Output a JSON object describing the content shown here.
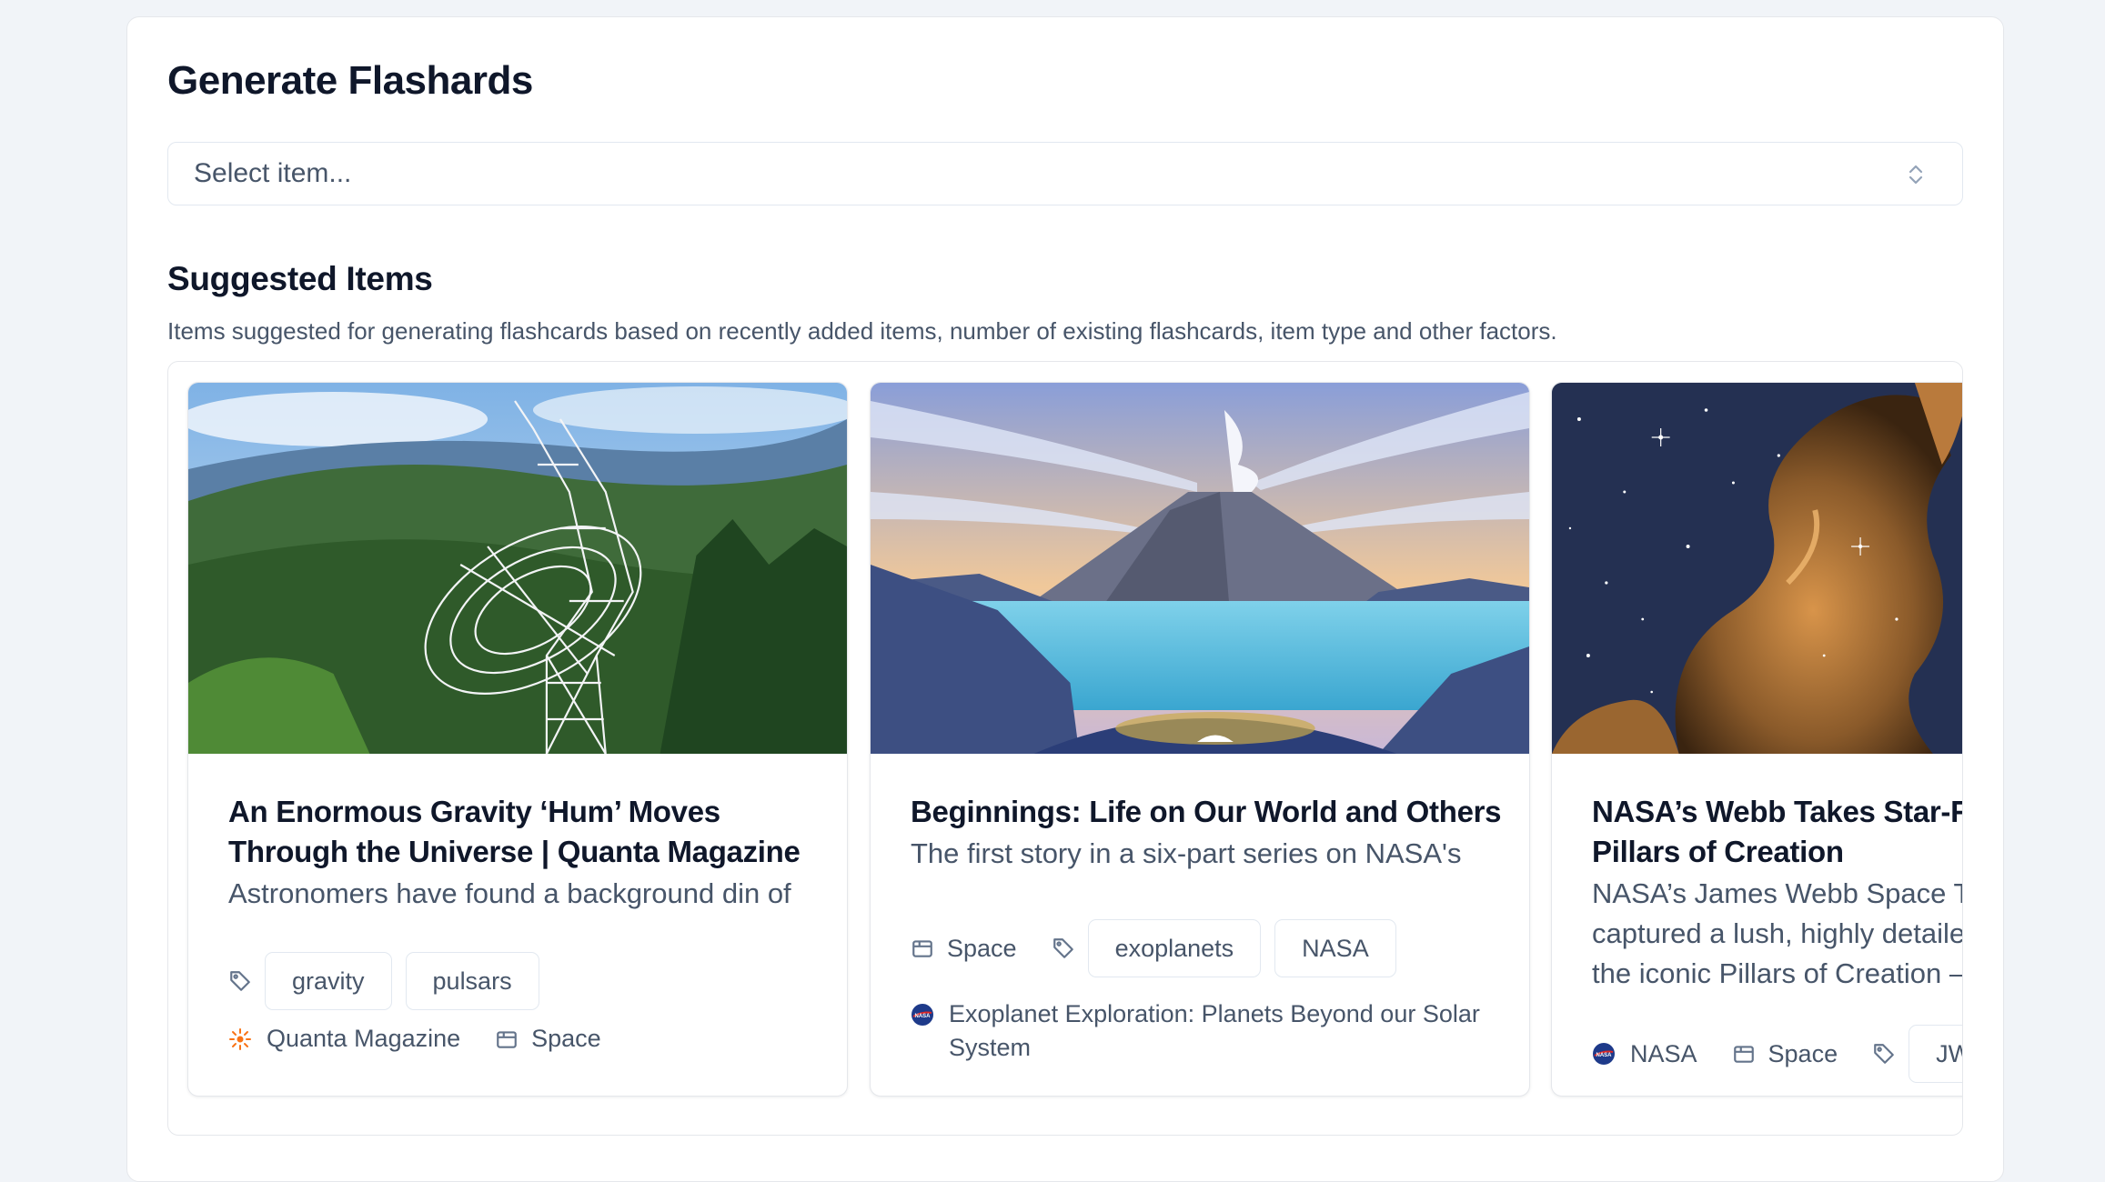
{
  "page": {
    "title": "Generate Flashards",
    "select_placeholder": "Select item...",
    "suggested_title": "Suggested Items",
    "suggested_desc": "Items suggested for generating flashcards based on recently added items, number of existing flashcards, item type and other factors."
  },
  "cards": [
    {
      "title": "An Enormous Gravity ‘Hum’ Moves Through the Universe | Quanta Magazine",
      "description": "Astronomers have found a background din of gravitational waves rippling through the universe.",
      "tags": [
        "gravity",
        "pulsars"
      ],
      "source": "Quanta Magazine",
      "category": "Space"
    },
    {
      "title": "Beginnings: Life on Our World and Others",
      "description": "The first story in a six-part series on NASA's Search for Life takes a close look at the origin of life.",
      "category": "Space",
      "tags": [
        "exoplanets",
        "NASA"
      ],
      "source": "Exoplanet Exploration: Planets Beyond our Solar System"
    },
    {
      "title": "NASA’s Webb Takes Star-Filled Portrait of Pillars of Creation",
      "description": "NASA’s James Webb Space Telescope has captured a lush, highly detailed landscape – the iconic Pillars of Creation – where new stars are forming.",
      "source": "NASA",
      "category": "Space",
      "tags": [
        "JWST"
      ]
    }
  ],
  "colors": {
    "background": "#f1f4f8",
    "panel": "#ffffff",
    "text_primary": "#0f172a",
    "text_secondary": "#475569",
    "border": "#e5e7eb",
    "quanta_orange": "#f97316",
    "nasa_blue": "#1e3a8a"
  }
}
